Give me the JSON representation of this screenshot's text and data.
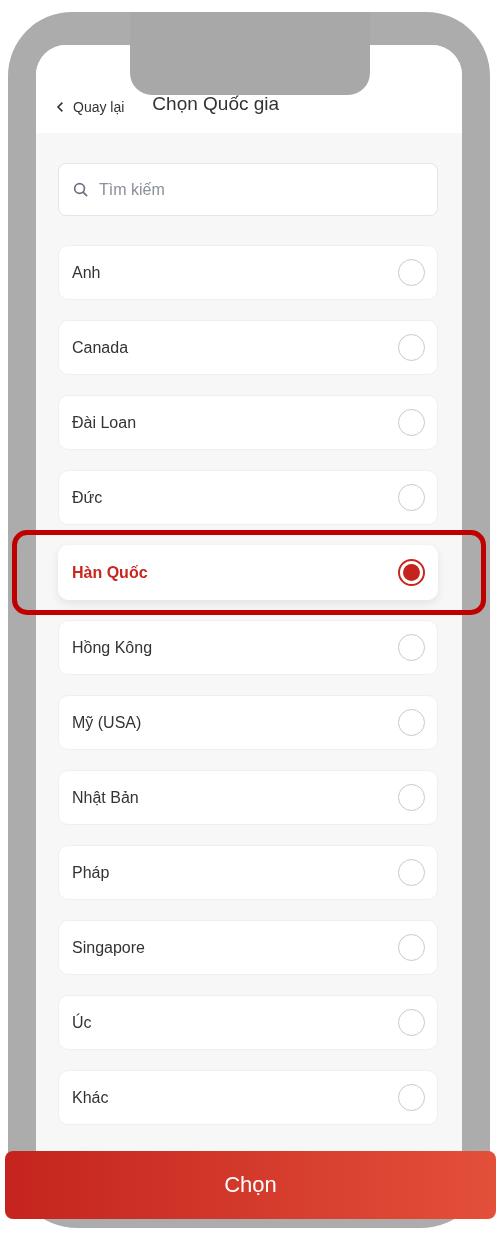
{
  "header": {
    "back_label": "Quay lại",
    "title": "Chọn Quốc gia"
  },
  "search": {
    "placeholder": "Tìm kiếm"
  },
  "countries": [
    {
      "name": "Anh",
      "selected": false
    },
    {
      "name": "Canada",
      "selected": false
    },
    {
      "name": "Đài Loan",
      "selected": false
    },
    {
      "name": "Đức",
      "selected": false
    },
    {
      "name": "Hàn Quốc",
      "selected": true
    },
    {
      "name": "Hồng Kông",
      "selected": false
    },
    {
      "name": "Mỹ (USA)",
      "selected": false
    },
    {
      "name": "Nhật Bản",
      "selected": false
    },
    {
      "name": "Pháp",
      "selected": false
    },
    {
      "name": "Singapore",
      "selected": false
    },
    {
      "name": "Úc",
      "selected": false
    },
    {
      "name": "Khác",
      "selected": false
    }
  ],
  "highlight_selected": true,
  "confirm_button": "Chọn"
}
